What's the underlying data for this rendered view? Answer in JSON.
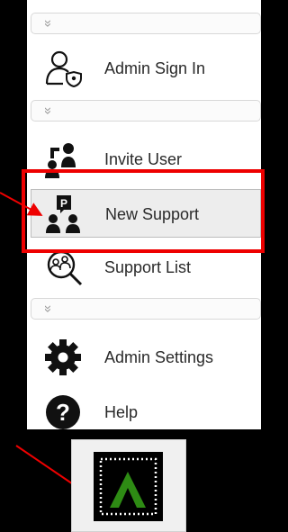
{
  "menu": {
    "collapse_glyph": "»",
    "items": [
      {
        "label": "Admin Sign In",
        "icon": "admin-sign-in-icon"
      },
      {
        "label": "Invite User",
        "icon": "invite-user-icon"
      },
      {
        "label": "New Support",
        "icon": "new-support-icon",
        "selected": true
      },
      {
        "label": "Support List",
        "icon": "support-list-icon"
      },
      {
        "label": "Admin Settings",
        "icon": "gear-icon"
      },
      {
        "label": "Help",
        "icon": "help-icon"
      }
    ]
  },
  "colors": {
    "annotation_red": "#ee0000",
    "tile_green": "#2e8b14"
  },
  "tile": {
    "icon": "app-launcher-icon"
  }
}
